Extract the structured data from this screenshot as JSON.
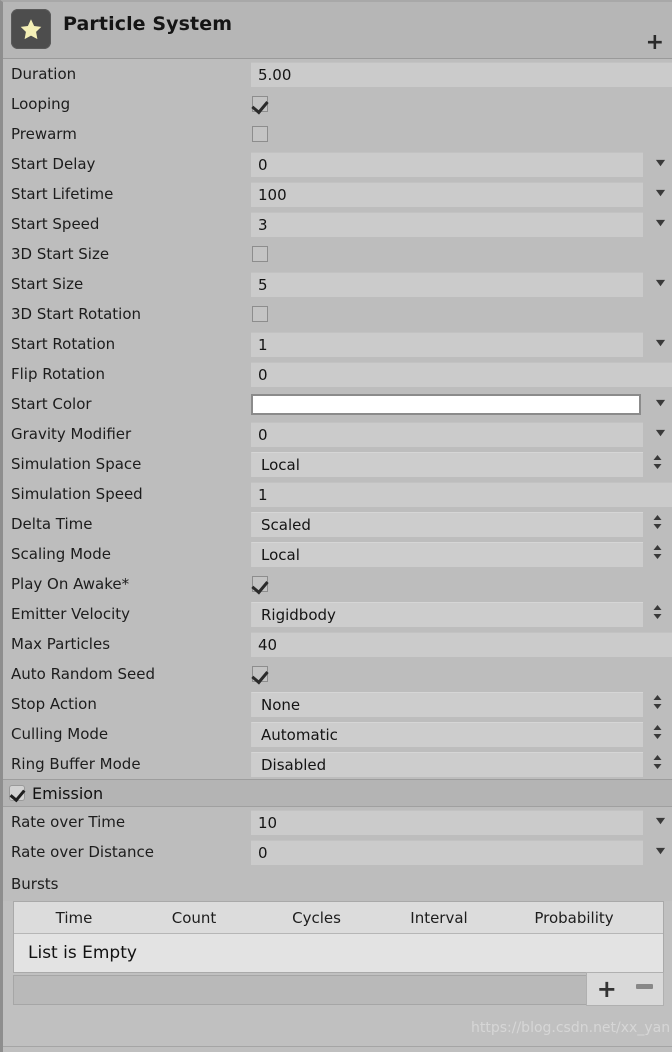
{
  "header": {
    "title": "Particle System",
    "icon": "particle-star-icon",
    "add_label": "+"
  },
  "main_module": {
    "rows": [
      {
        "label": "Duration",
        "value": "5.00",
        "type": "text",
        "arrow": "none"
      },
      {
        "label": "Looping",
        "value": true,
        "type": "check",
        "arrow": "none"
      },
      {
        "label": "Prewarm",
        "value": false,
        "type": "check",
        "arrow": "none"
      },
      {
        "label": "Start Delay",
        "value": "0",
        "type": "text",
        "arrow": "curve"
      },
      {
        "label": "Start Lifetime",
        "value": "100",
        "type": "text",
        "arrow": "curve"
      },
      {
        "label": "Start Speed",
        "value": "3",
        "type": "text",
        "arrow": "curve"
      },
      {
        "label": "3D Start Size",
        "value": false,
        "type": "check",
        "arrow": "none"
      },
      {
        "label": "Start Size",
        "value": "5",
        "type": "text",
        "arrow": "curve"
      },
      {
        "label": "3D Start Rotation",
        "value": false,
        "type": "check",
        "arrow": "none"
      },
      {
        "label": "Start Rotation",
        "value": "1",
        "type": "text",
        "arrow": "curve"
      },
      {
        "label": "Flip Rotation",
        "value": "0",
        "type": "text",
        "arrow": "none"
      },
      {
        "label": "Start Color",
        "value": "#ffffff",
        "type": "color",
        "arrow": "curve"
      },
      {
        "label": "Gravity Modifier",
        "value": "0",
        "type": "text",
        "arrow": "curve"
      },
      {
        "label": "Simulation Space",
        "value": "Local",
        "type": "enum",
        "arrow": "enum"
      },
      {
        "label": "Simulation Speed",
        "value": "1",
        "type": "text",
        "arrow": "none"
      },
      {
        "label": "Delta Time",
        "value": "Scaled",
        "type": "enum",
        "arrow": "enum"
      },
      {
        "label": "Scaling Mode",
        "value": "Local",
        "type": "enum",
        "arrow": "enum"
      },
      {
        "label": "Play On Awake*",
        "value": true,
        "type": "check",
        "arrow": "none"
      },
      {
        "label": "Emitter Velocity",
        "value": "Rigidbody",
        "type": "enum",
        "arrow": "enum"
      },
      {
        "label": "Max Particles",
        "value": "40",
        "type": "text",
        "arrow": "none"
      },
      {
        "label": "Auto Random Seed",
        "value": true,
        "type": "check",
        "arrow": "none"
      },
      {
        "label": "Stop Action",
        "value": "None",
        "type": "enum",
        "arrow": "enum"
      },
      {
        "label": "Culling Mode",
        "value": "Automatic",
        "type": "enum",
        "arrow": "enum"
      },
      {
        "label": "Ring Buffer Mode",
        "value": "Disabled",
        "type": "enum",
        "arrow": "enum"
      }
    ]
  },
  "emission_module": {
    "title": "Emission",
    "enabled": true,
    "rows": [
      {
        "label": "Rate over Time",
        "value": "10",
        "type": "text",
        "arrow": "curve"
      },
      {
        "label": "Rate over Distance",
        "value": "0",
        "type": "text",
        "arrow": "curve"
      }
    ],
    "bursts": {
      "label": "Bursts",
      "columns": [
        "Time",
        "Count",
        "Cycles",
        "Interval",
        "Probability"
      ],
      "empty_text": "List is Empty",
      "rows": [],
      "add_label": "+",
      "remove_label": "-"
    }
  },
  "watermark": "https://blog.csdn.net/xx_yan",
  "colors": {
    "panel_bg": "#c0c0c0",
    "row_bg": "#bdbdbd",
    "field_bg": "#cbcbcb",
    "header_bg": "#b6b6b6",
    "icon_bg": "#4d4d4d",
    "star": "#f2eeb3",
    "table_head": "#dcdcdc",
    "table_body": "#e3e3e3"
  }
}
